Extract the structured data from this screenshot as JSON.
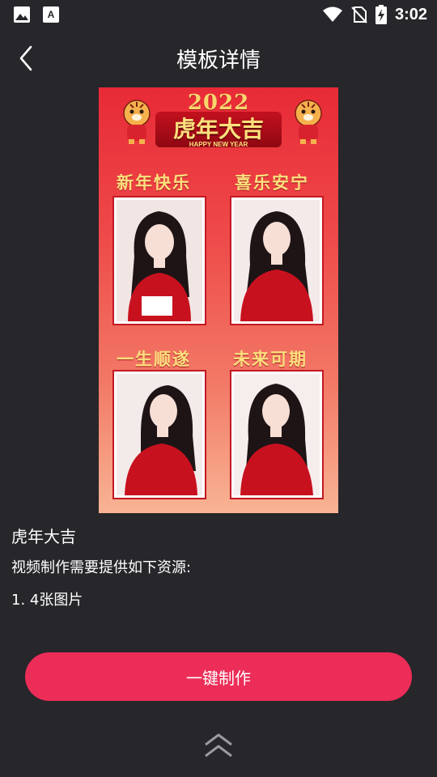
{
  "status_bar": {
    "time": "3:02",
    "icons": [
      "image-icon",
      "font-download-icon",
      "wifi-icon",
      "no-sim-icon",
      "battery-charging-icon"
    ]
  },
  "header": {
    "title": "模板详情",
    "back_icon": "chevron-left-icon"
  },
  "poster": {
    "year": "2022",
    "title": "虎年大吉",
    "subtitle": "HAPPY NEW YEAR",
    "captions": [
      "新年快乐",
      "喜乐安宁",
      "一生顺遂",
      "未来可期"
    ],
    "colors": {
      "background": "#e82a37",
      "gold": "#fbe07d",
      "frame": "#c41822"
    }
  },
  "template": {
    "name": "虎年大吉",
    "requirement": "视频制作需要提供如下资源:",
    "resource_item": "1. 4张图片"
  },
  "action": {
    "label": "一键制作",
    "color": "#ec2d58"
  },
  "expand_icon": "double-chevron-up-icon"
}
